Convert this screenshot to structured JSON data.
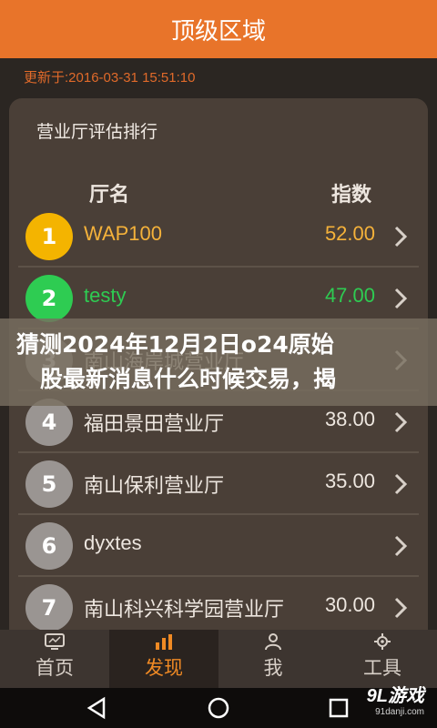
{
  "title": "顶级区域",
  "updated": "更新于:2016-03-31 15:51:10",
  "card_title": "营业厅评估排行",
  "columns": {
    "name": "厅名",
    "score": "指数"
  },
  "rows": [
    {
      "rank": "1",
      "name": "WAP100",
      "score": "52.00",
      "badge": "#f4b400",
      "text": "#f5b23a"
    },
    {
      "rank": "2",
      "name": "testy",
      "score": "47.00",
      "badge": "#2ecc52",
      "text": "#2ecc52"
    },
    {
      "rank": "3",
      "name": "南山海岸城营业厅",
      "score": "",
      "badge": "#9a9592",
      "text": "#ede6df"
    },
    {
      "rank": "4",
      "name": "福田景田营业厅",
      "score": "38.00",
      "badge": "#9a9592",
      "text": "#ede6df"
    },
    {
      "rank": "5",
      "name": "南山保利营业厅",
      "score": "35.00",
      "badge": "#9a9592",
      "text": "#ede6df"
    },
    {
      "rank": "6",
      "name": "dyxtes",
      "score": "",
      "badge": "#9a9592",
      "text": "#ede6df"
    },
    {
      "rank": "7",
      "name": "南山科兴科学园营业厅",
      "score": "30.00",
      "badge": "#9a9592",
      "text": "#ede6df"
    }
  ],
  "overlay": {
    "line1": "猜测2024年12月2日o24原始",
    "line2": "股最新消息什么时候交易，揭"
  },
  "tabs": [
    {
      "label": "首页",
      "icon": "monitor-icon",
      "active": false
    },
    {
      "label": "发现",
      "icon": "bar-chart-icon",
      "active": true
    },
    {
      "label": "我",
      "icon": "user-icon",
      "active": false
    },
    {
      "label": "工具",
      "icon": "tools-icon",
      "active": false
    }
  ],
  "watermark": {
    "brand": "9L游戏",
    "url": "91danji.com"
  },
  "colors": {
    "accent": "#e8742a",
    "header": "#f08a24"
  }
}
